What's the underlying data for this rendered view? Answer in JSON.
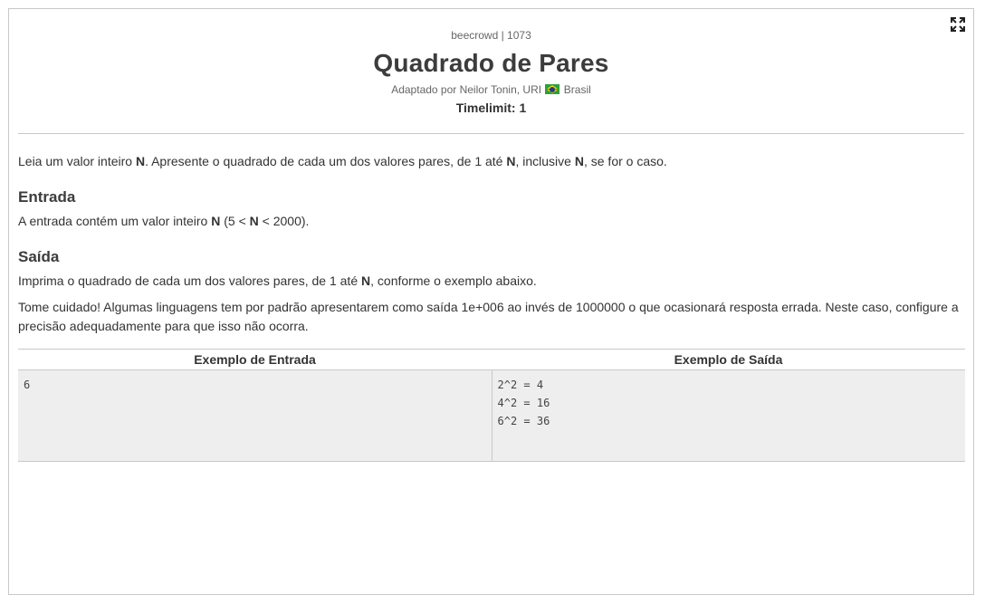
{
  "header": {
    "source": "beecrowd | 1073",
    "title": "Quadrado de Pares",
    "author_prefix": "Adaptado por Neilor Tonin, URI",
    "country": "Brasil",
    "timelimit": "Timelimit: 1"
  },
  "description": {
    "part1": "Leia um valor inteiro ",
    "n1": "N",
    "part2": ". Apresente o quadrado de cada um dos valores pares, de 1 até ",
    "n2": "N",
    "part3": ", inclusive ",
    "n3": "N",
    "part4": ", se for o caso."
  },
  "input_section": {
    "heading": "Entrada",
    "part1": "A entrada contém um valor inteiro ",
    "n1": "N",
    "part2": " (5 < ",
    "n2": "N",
    "part3": " < 2000)."
  },
  "output_section": {
    "heading": "Saída",
    "part1": "Imprima o quadrado de cada um dos valores pares, de 1 até ",
    "n1": "N",
    "part2": ", conforme o exemplo abaixo.",
    "note": "Tome cuidado! Algumas linguagens tem por padrão apresentarem como saída 1e+006 ao invés de 1000000 o que ocasionará resposta errada. Neste caso, configure a precisão adequadamente para que isso não ocorra."
  },
  "examples": {
    "input_header": "Exemplo de Entrada",
    "output_header": "Exemplo de Saída",
    "input": "6",
    "output": "2^2 = 4\n4^2 = 16\n6^2 = 36"
  },
  "icons": {
    "expand": "expand-icon",
    "flag": "brazil-flag-icon"
  }
}
